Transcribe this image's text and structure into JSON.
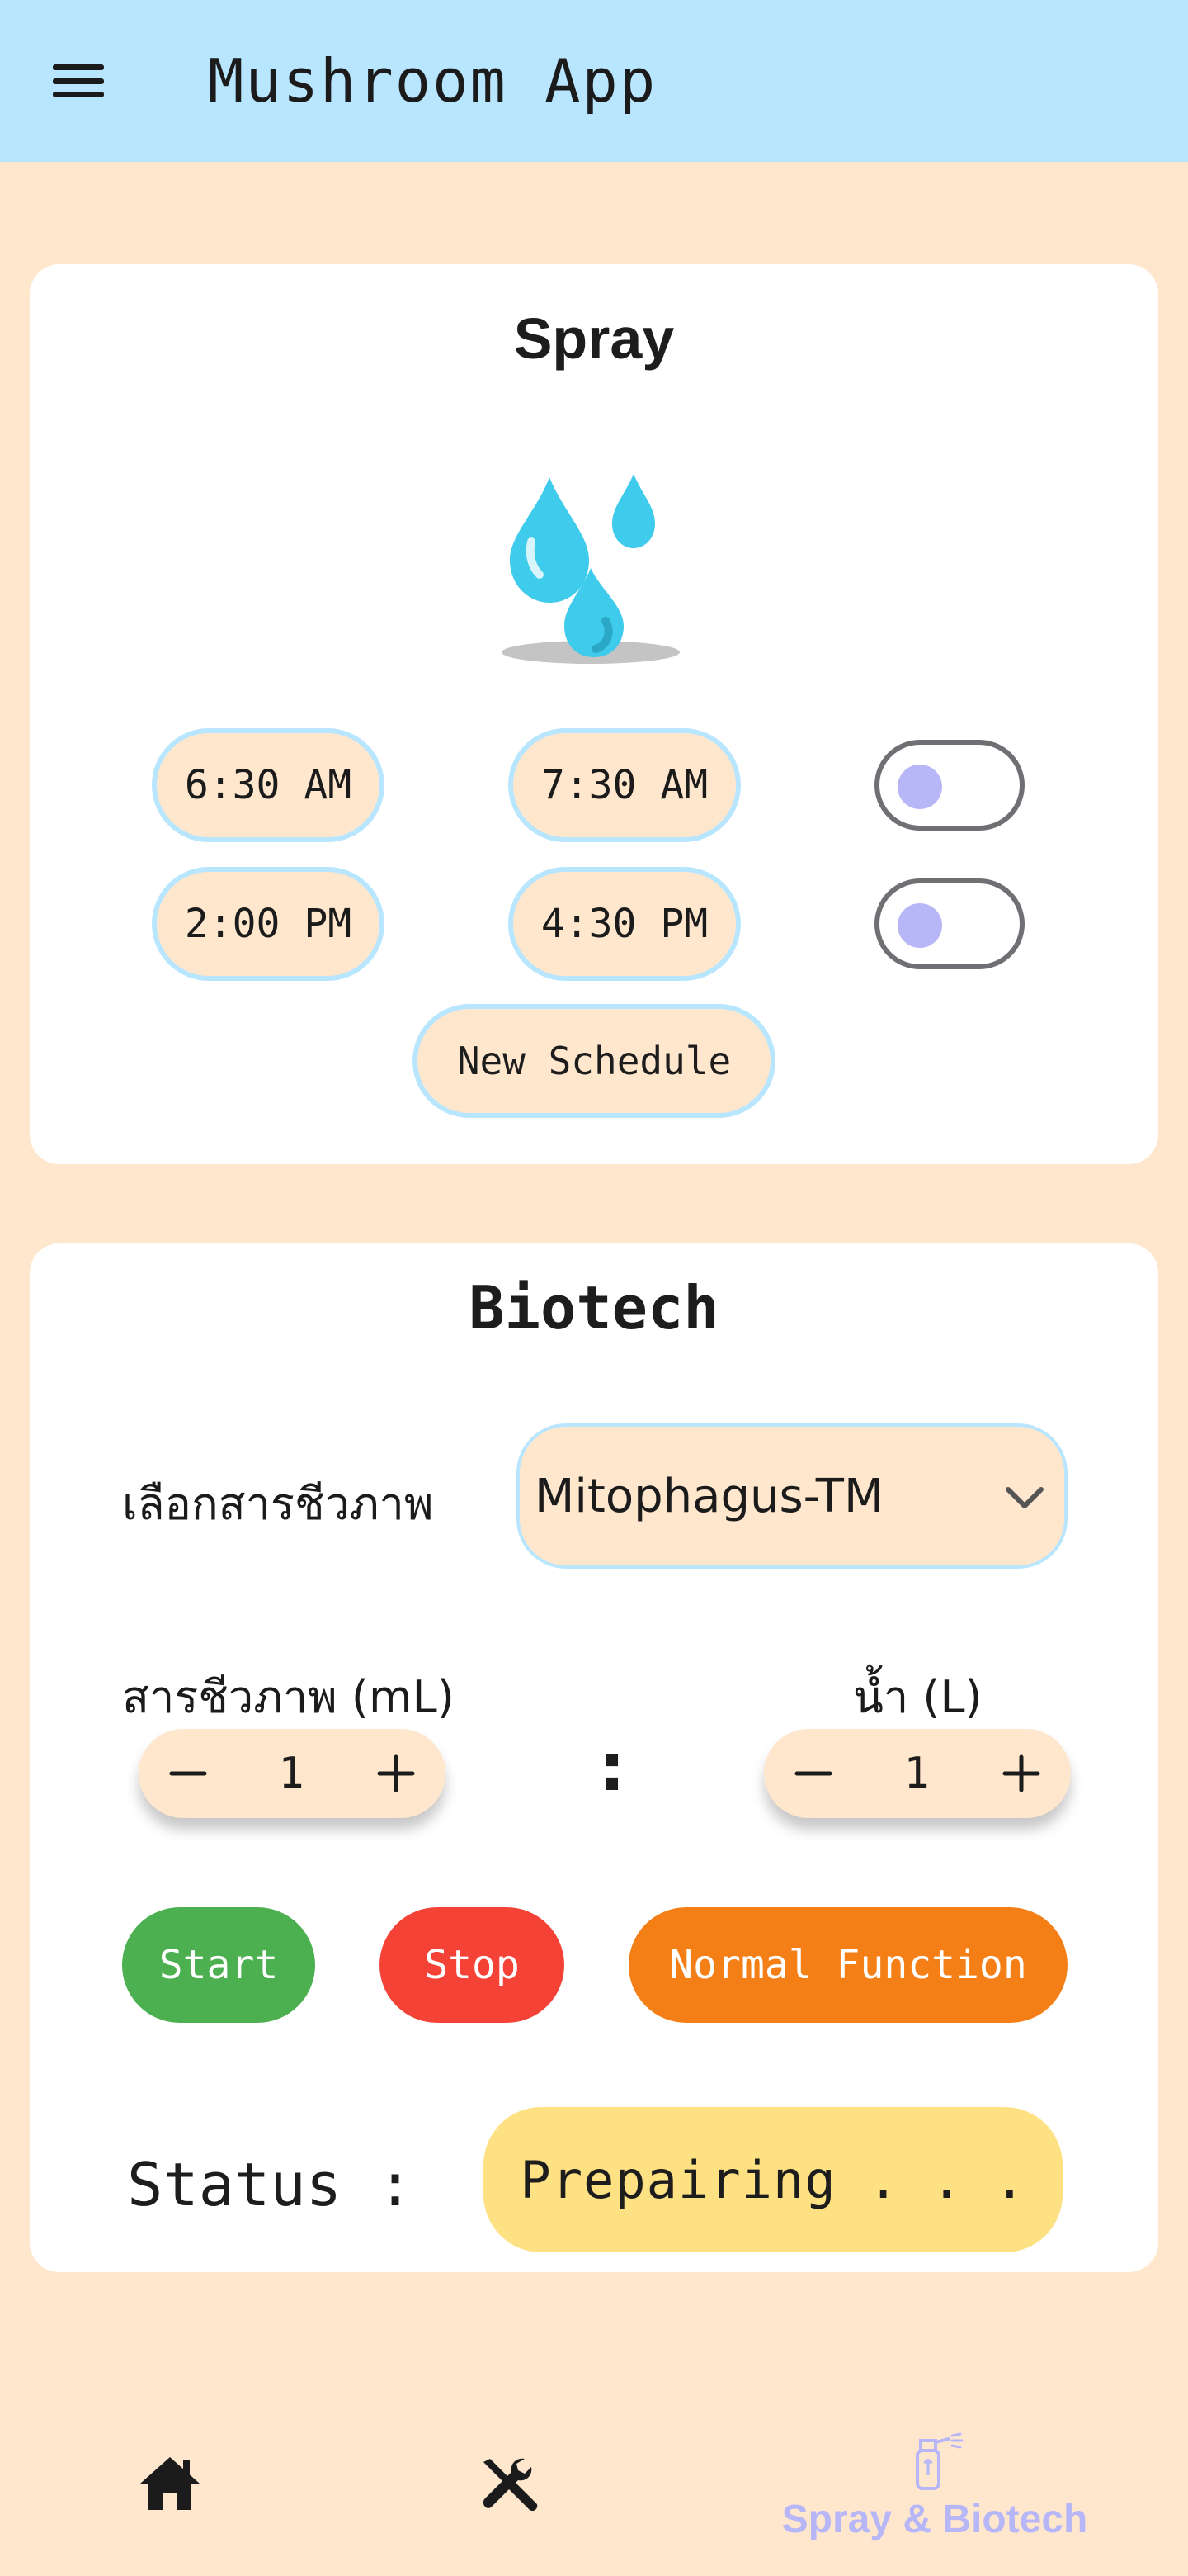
{
  "app": {
    "title": "Mushroom App"
  },
  "spray": {
    "title": "Spray",
    "schedules": [
      {
        "start": "6:30 AM",
        "end": "7:30 AM",
        "enabled": false
      },
      {
        "start": "2:00 PM",
        "end": "4:30 PM",
        "enabled": false
      }
    ],
    "new_schedule_label": "New Schedule"
  },
  "biotech": {
    "title": "Biotech",
    "select_label": "เลือกสารชีวภาพ",
    "selected": "Mitophagus-TM",
    "bio_amount_label": "สารชีวภาพ (mL)",
    "bio_amount": "1",
    "water_label": "น้ำ (L)",
    "water_amount": "1",
    "ratio_separator": ":",
    "buttons": {
      "start": "Start",
      "stop": "Stop",
      "normal": "Normal Function"
    },
    "status_label": "Status :",
    "status_value": "Prepairing . . ."
  },
  "bottom_nav": {
    "items": [
      {
        "icon": "home-icon"
      },
      {
        "icon": "tools-icon"
      },
      {
        "icon": "spray-bottle-icon",
        "label": "Spray & Biotech",
        "active": true
      }
    ]
  },
  "colors": {
    "appbar": "#B8E6FE",
    "background": "#FFE7CE",
    "accent": "#B7B6F7",
    "start": "#4CAF50",
    "stop": "#F44336",
    "normal": "#F57F17",
    "status": "#FDE183"
  }
}
